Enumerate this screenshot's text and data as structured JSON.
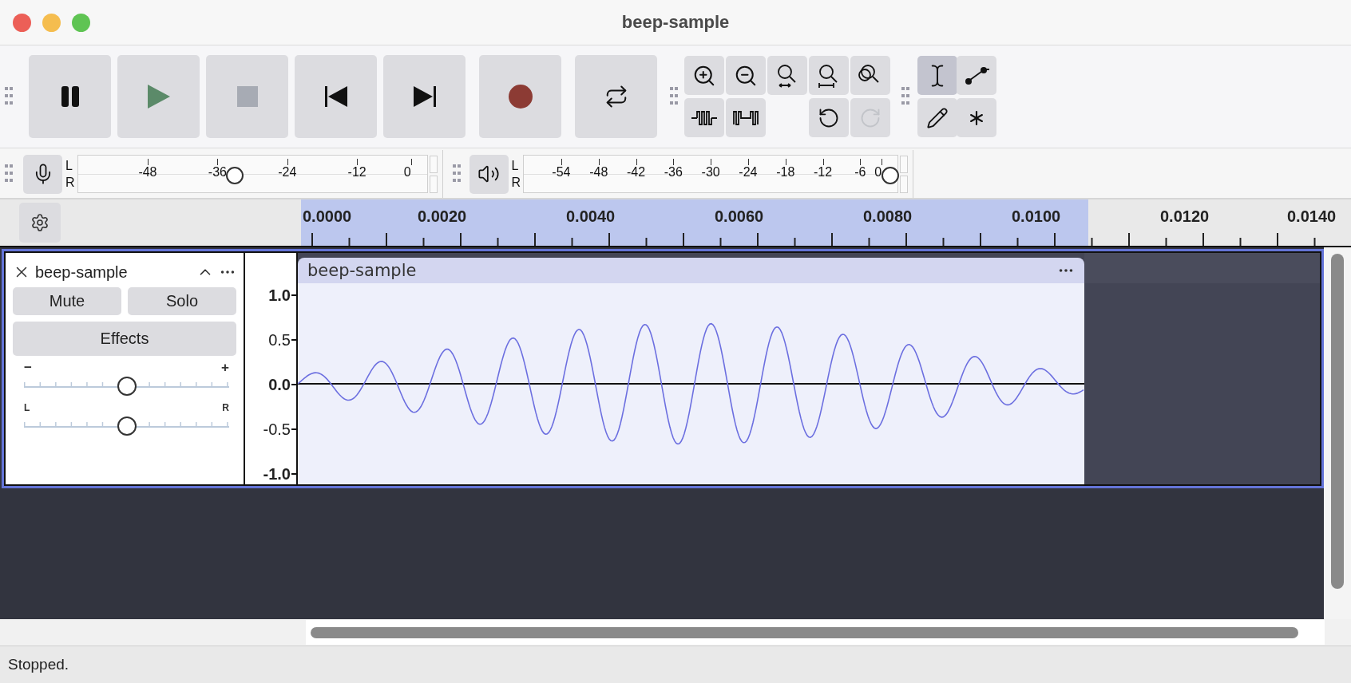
{
  "window": {
    "title": "beep-sample"
  },
  "transport": [
    {
      "kind": "pause"
    },
    {
      "kind": "play"
    },
    {
      "kind": "stop"
    },
    {
      "kind": "skip-start"
    },
    {
      "kind": "skip-end"
    },
    {
      "kind": "record"
    },
    {
      "kind": "loop"
    }
  ],
  "zoom_buttons": [
    {
      "kind": "zoom-in"
    },
    {
      "kind": "zoom-out"
    },
    {
      "kind": "fit-selection"
    },
    {
      "kind": "fit-project"
    },
    {
      "kind": "zoom-toggle"
    }
  ],
  "edit_buttons": [
    {
      "kind": "trim"
    },
    {
      "kind": "silence"
    }
  ],
  "history_buttons": [
    {
      "kind": "undo",
      "disabled": false
    },
    {
      "kind": "redo",
      "disabled": true
    }
  ],
  "tools": [
    {
      "kind": "select",
      "selected": true
    },
    {
      "kind": "envelope",
      "selected": false
    },
    {
      "kind": "draw",
      "selected": false
    },
    {
      "kind": "multi",
      "selected": false
    }
  ],
  "recording_meter": {
    "channels": [
      "L",
      "R"
    ],
    "ticks": [
      "-48",
      "-36",
      "-24",
      "-12",
      "0"
    ],
    "level": 0.45
  },
  "playback_meter": {
    "channels": [
      "L",
      "R"
    ],
    "ticks": [
      "-54",
      "-48",
      "-42",
      "-36",
      "-30",
      "-24",
      "-18",
      "-12",
      "-6",
      "0"
    ],
    "level": 0.98
  },
  "ruler": {
    "labels": [
      "0.0000",
      "0.0020",
      "0.0040",
      "0.0060",
      "0.0080",
      "0.0100",
      "0.0120",
      "0.0140"
    ],
    "selection": {
      "level": 0.75
    }
  },
  "track": {
    "name": "beep-sample",
    "selected": true,
    "buttons": [
      "Mute",
      "Solo"
    ],
    "effects": "Effects",
    "gain": {
      "min": "−",
      "max": "+",
      "level": 0.5
    },
    "pan": {
      "min": "L",
      "max": "R",
      "level": 0.5
    },
    "scale": [
      {
        "label": "1.0",
        "major": true
      },
      {
        "label": "0.5",
        "major": false
      },
      {
        "label": "0.0",
        "major": true
      },
      {
        "label": "-0.5",
        "major": false
      },
      {
        "label": "-1.0",
        "major": true
      }
    ],
    "clip": {
      "name": "beep-sample"
    }
  },
  "status_bar": {
    "text": "Stopped."
  }
}
